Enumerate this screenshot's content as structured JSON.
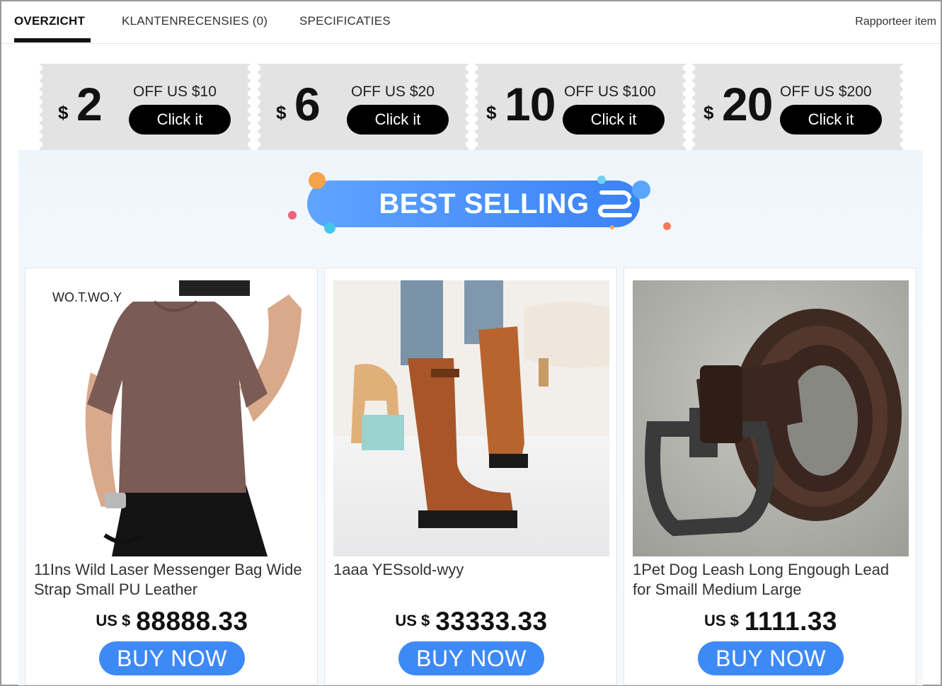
{
  "tabs": [
    {
      "label": "OVERZICHT",
      "active": true
    },
    {
      "label": "KLANTENRECENSIES (0)",
      "active": false
    },
    {
      "label": "SPECIFICATIES",
      "active": false
    }
  ],
  "report_link": "Rapporteer item",
  "coupons": [
    {
      "currency": "$",
      "amount": "2",
      "condition": "OFF US $10",
      "button": "Click it"
    },
    {
      "currency": "$",
      "amount": "6",
      "condition": "OFF US $20",
      "button": "Click it"
    },
    {
      "currency": "$",
      "amount": "10",
      "condition": "OFF US $100",
      "button": "Click it"
    },
    {
      "currency": "$",
      "amount": "20",
      "condition": "OFF US $200",
      "button": "Click it"
    }
  ],
  "banner": {
    "title": "BEST SELLING"
  },
  "products": [
    {
      "photo_brand": "WO.T.WO.Y",
      "title": "11Ins Wild Laser Messenger Bag Wide Strap Small PU Leather",
      "currency": "US $",
      "price": "88888.33",
      "button": "BUY NOW"
    },
    {
      "title": "1aaa YESsold-wyy",
      "currency": "US $",
      "price": "33333.33",
      "button": "BUY NOW"
    },
    {
      "title": "1Pet Dog Leash Long Engough Lead for Smaill Medium Large",
      "currency": "US $",
      "price": "1111.33",
      "button": "BUY NOW"
    }
  ],
  "colors": {
    "buy_button": "#3d8af7",
    "coupon_bg": "#e3e3e3",
    "banner_pill": "#3b82f6"
  }
}
